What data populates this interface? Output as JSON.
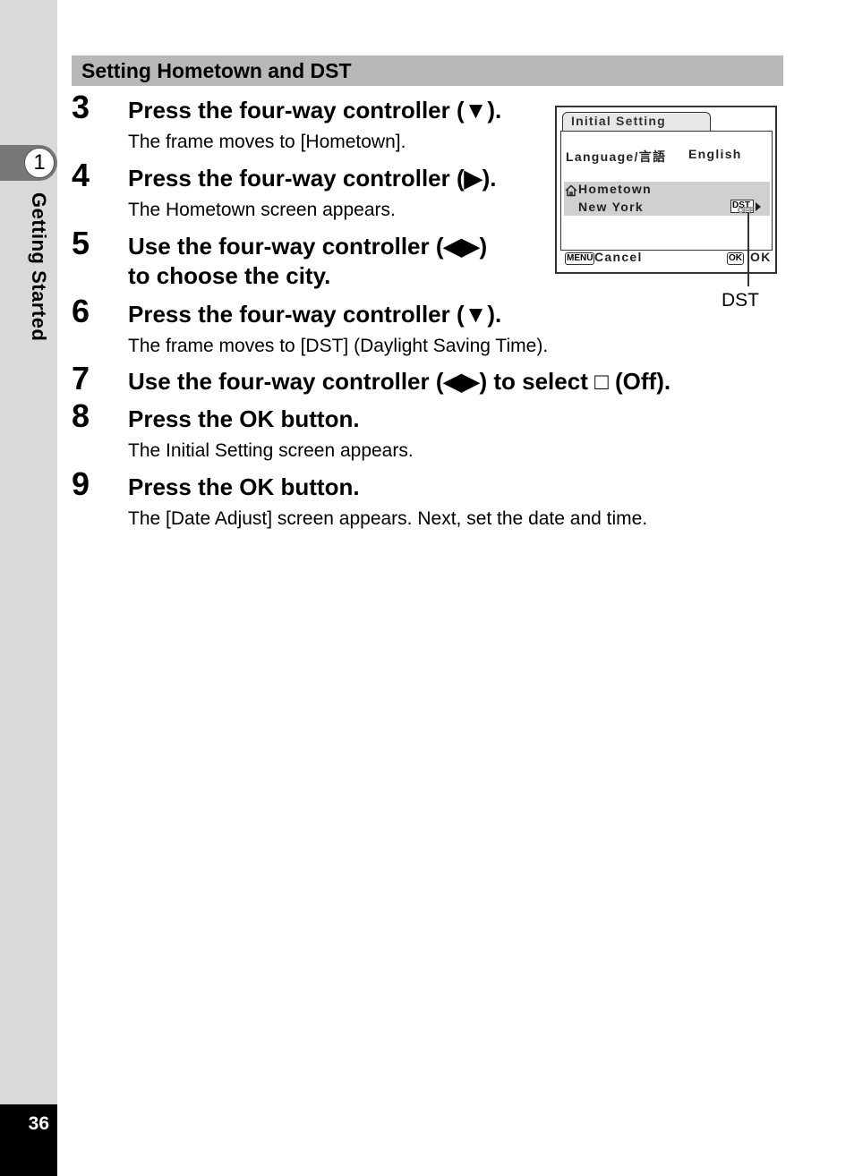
{
  "sidebar": {
    "chapter_number": "1",
    "chapter_title": "Getting Started",
    "page_number": "36"
  },
  "section": {
    "title": "Setting Hometown and DST"
  },
  "steps": [
    {
      "number": "3",
      "title": "Press the four-way controller (▼).",
      "description": "The frame moves to [Hometown]."
    },
    {
      "number": "4",
      "title": "Press the four-way controller (▶).",
      "description": "The Hometown screen appears."
    },
    {
      "number": "5",
      "title_line1": "Use the four-way controller (◀▶)",
      "title_line2": "to choose the city."
    },
    {
      "number": "6",
      "title": "Press the four-way controller (▼).",
      "description": "The frame moves to [DST] (Daylight Saving Time)."
    },
    {
      "number": "7",
      "title": "Use the four-way controller (◀▶) to select □ (Off)."
    },
    {
      "number": "8",
      "title": "Press the OK button.",
      "description": "The Initial Setting screen appears."
    },
    {
      "number": "9",
      "title": "Press the OK button.",
      "description": "The [Date Adjust] screen appears. Next, set the date and time."
    }
  ],
  "camera_screen": {
    "tab_title": "Initial Setting",
    "language_label": "Language/言語",
    "language_value": "English",
    "hometown_label": "Hometown",
    "hometown_value": "New York",
    "dst_badge": "DST",
    "dst_state": "OFF",
    "menu_key": "MENU",
    "cancel_label": "Cancel",
    "ok_key": "OK",
    "ok_label": "OK"
  },
  "callout": {
    "dst_label": "DST"
  }
}
